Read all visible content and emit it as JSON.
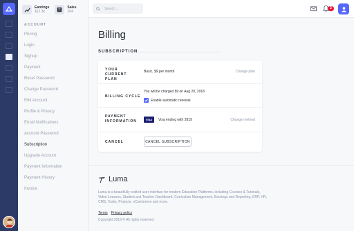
{
  "sidebar": {
    "stats": [
      {
        "title": "Earnings",
        "value": "$12.3k",
        "icon": "trending-up-icon"
      },
      {
        "title": "Sales",
        "value": "264",
        "icon": "receipt-icon"
      }
    ],
    "section_label": "ACCOUNT",
    "items": [
      {
        "label": "Pricing"
      },
      {
        "label": "Login"
      },
      {
        "label": "Signup"
      },
      {
        "label": "Payment"
      },
      {
        "label": "Reset Password"
      },
      {
        "label": "Change Password"
      },
      {
        "label": "Edit Account"
      },
      {
        "label": "Profile & Privacy"
      },
      {
        "label": "Email Notifications"
      },
      {
        "label": "Account Password"
      },
      {
        "label": "Subscription",
        "active": true
      },
      {
        "label": "Upgrade Account"
      },
      {
        "label": "Payment Information"
      },
      {
        "label": "Payment History"
      },
      {
        "label": "Invoice"
      }
    ]
  },
  "topbar": {
    "search_placeholder": "Search ...",
    "notification_count": "2"
  },
  "main": {
    "title": "Billing",
    "section": "SUBSCRIPTION",
    "rows": {
      "plan": {
        "label": "YOUR CURRENT PLAN",
        "text": "Basic, $9 per month",
        "action": "Change plan"
      },
      "cycle": {
        "label": "BILLING CYCLE",
        "text": "You will be charged $9 on Aug 20, 2018",
        "checkbox_label": "Enable automatic renewal",
        "checkbox_checked": true
      },
      "payment": {
        "label": "PAYMENT INFORMATION",
        "card_brand": "VISA",
        "text": "Visa ending with 2819",
        "action": "Change method"
      },
      "cancel": {
        "label": "CANCEL",
        "button": "CANCEL SUBSCRIPTION"
      }
    }
  },
  "footer": {
    "brand": "Luma",
    "description": "Luma is a beautifully crafted user interface for modern Education Platforms, including Courses & Tutorials, Video Lessons, Student and Teacher Dashboard, Curriculum Management, Earnings and Reporting, ERP, HR, CMS, Tasks, Projects, eCommerce and more.",
    "links": [
      "Terms",
      "Privacy policy"
    ],
    "copyright": "Copyright 2019 © All rights reserved."
  },
  "colors": {
    "accent": "#5567ff",
    "rail": "#2b3a67",
    "badge": "#e5163d"
  }
}
